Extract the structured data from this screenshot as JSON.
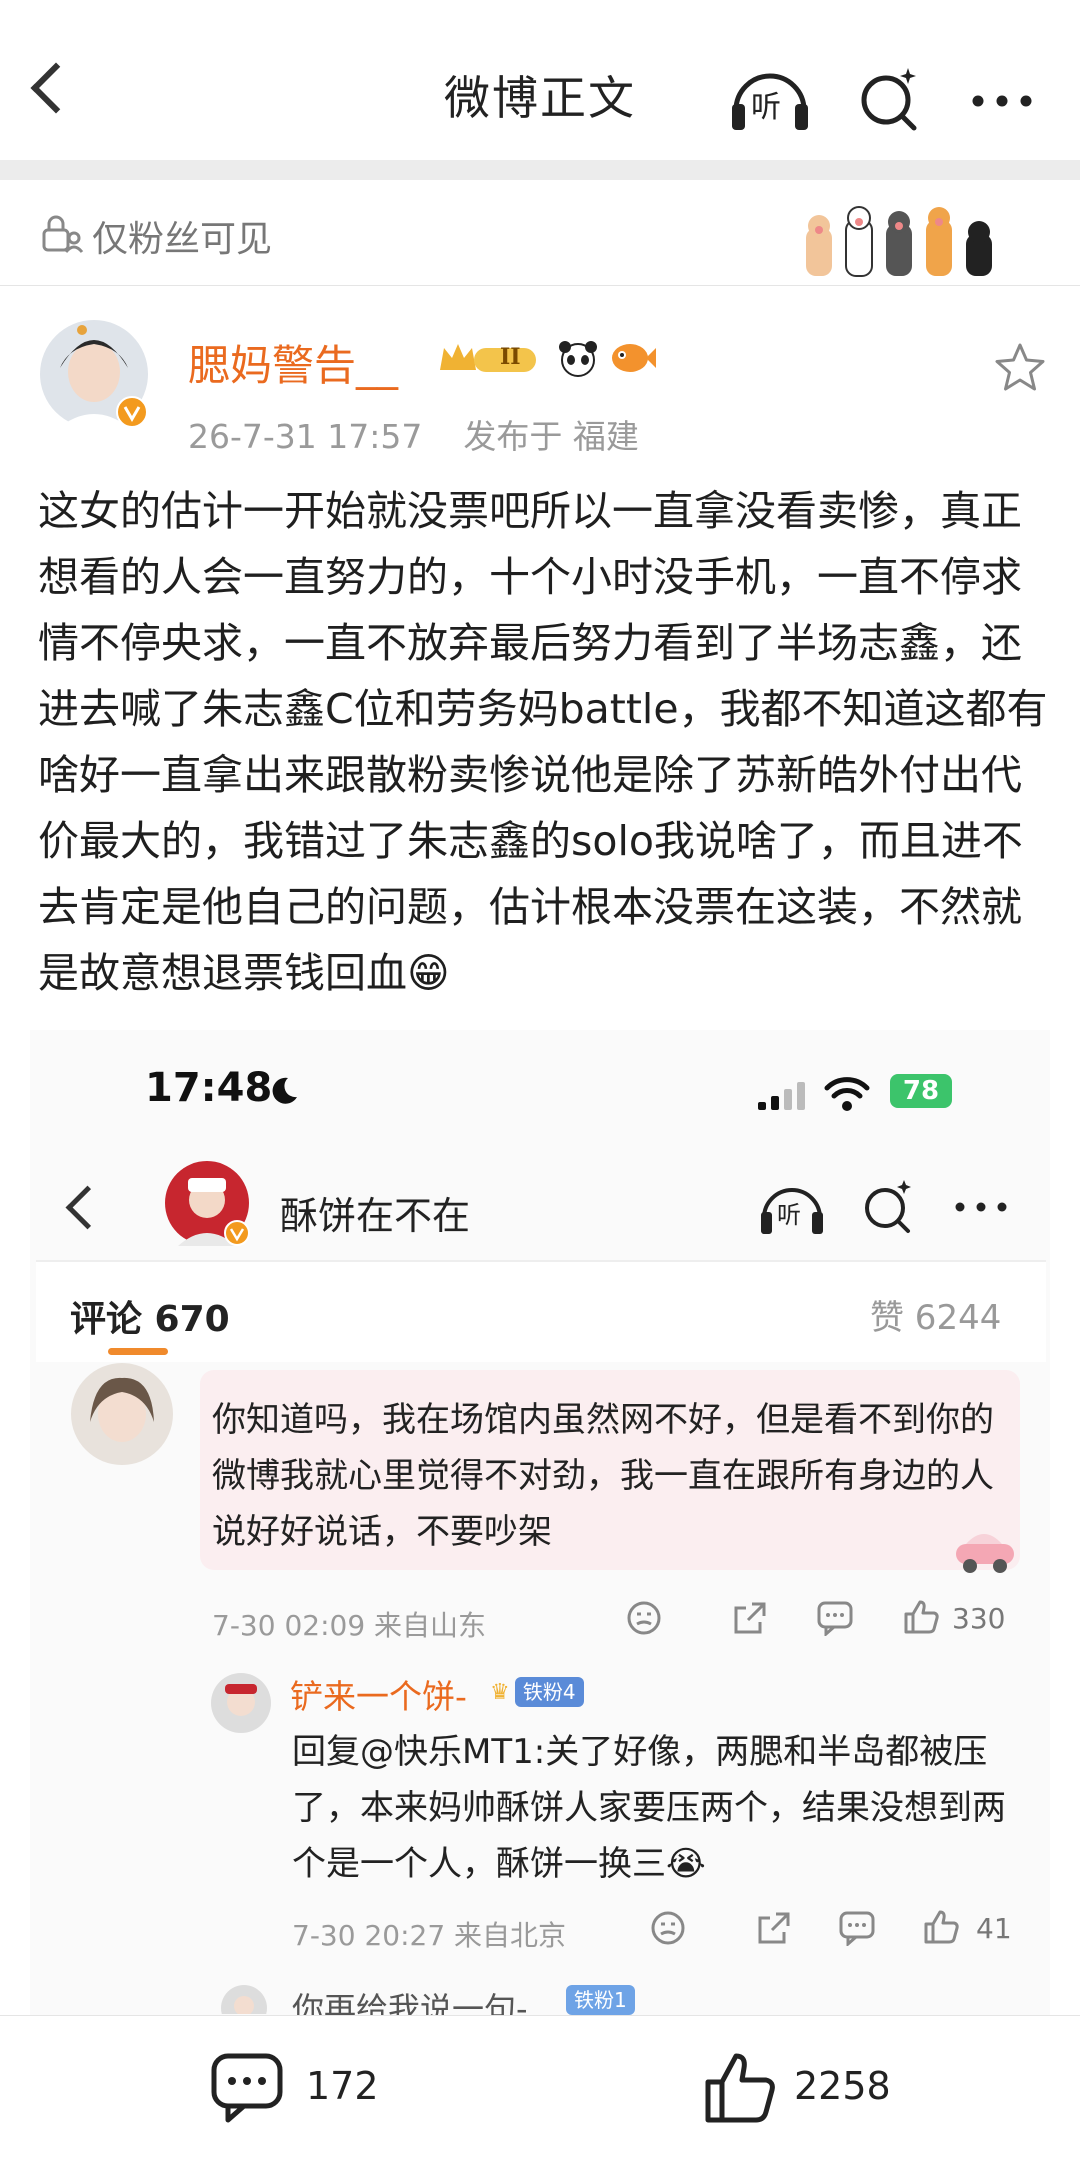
{
  "nav": {
    "title": "微博正文",
    "listen_label": "听"
  },
  "fans_only": {
    "label": "仅粉丝可见"
  },
  "post": {
    "author": "腮妈警告__",
    "badge_level": "II",
    "timestamp": "26-7-31 17:57",
    "location": "发布于 福建",
    "text": "这女的估计一开始就没票吧所以一直拿没看卖惨，真正想看的人会一直努力的，十个小时没手机，一直不停求情不停央求，一直不放弃最后努力看到了半场志鑫，还进去喊了朱志鑫C位和劳务妈battle，我都不知道这都有啥好一直拿出来跟散粉卖惨说他是除了苏新皓外付出代价最大的，我错过了朱志鑫的solo我说啥了，而且进不去肯定是他自己的问题，估计根本没票在这装，不然就是故意想退票钱回血😁"
  },
  "embedded": {
    "status_time": "17:48",
    "battery": "78",
    "nav_title": "酥饼在不在",
    "listen_label": "听",
    "tab_comments": "评论 670",
    "tab_likes": "赞 6244",
    "comment1": {
      "text": "你知道吗，我在场馆内虽然网不好，但是看不到你的微博我就心里觉得不对劲，我一直在跟所有身边的人说好好说话，不要吵架",
      "meta": "7-30 02:09 来自山东",
      "likes": "330"
    },
    "reply1": {
      "name": "铲来一个饼-",
      "badge": "铁粉4",
      "text": "回复@快乐MT1:关了好像，两腮和半岛都被压了，本来妈帅酥饼人家要压两个，结果没想到两个是一个人，酥饼一换三😭",
      "meta": "7-30 20:27 来自北京",
      "likes": "41"
    },
    "reply2": {
      "name": "你再给我说一句-",
      "badge": "铁粉1"
    }
  },
  "bottom": {
    "comments": "172",
    "likes": "2258"
  }
}
